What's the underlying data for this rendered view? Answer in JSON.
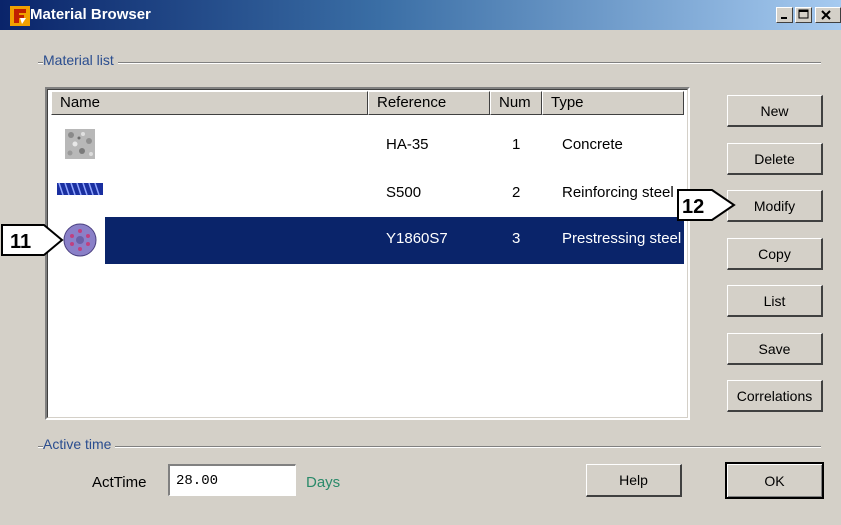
{
  "window": {
    "title": "Material Browser",
    "controls": [
      "minimize",
      "maximize",
      "close"
    ]
  },
  "material_list": {
    "group_label": "Material list",
    "columns": [
      "Name",
      "Reference",
      "Num",
      "Type"
    ],
    "rows": [
      {
        "icon": "concrete-texture-icon",
        "reference": "HA-35",
        "num": "1",
        "type": "Concrete",
        "selected": false
      },
      {
        "icon": "rebar-icon",
        "reference": "S500",
        "num": "2",
        "type": "Reinforcing steel",
        "selected": false
      },
      {
        "icon": "prestressing-strand-icon",
        "reference": "Y1860S7",
        "num": "3",
        "type": "Prestressing steel",
        "selected": true
      }
    ]
  },
  "buttons": {
    "new": "New",
    "delete": "Delete",
    "modify": "Modify",
    "copy": "Copy",
    "list": "List",
    "save": "Save",
    "correlations": "Correlations",
    "help": "Help",
    "ok": "OK"
  },
  "active_time": {
    "group_label": "Active time",
    "label": "ActTime",
    "value": "28.00",
    "unit": "Days"
  },
  "callouts": {
    "left": "11",
    "right": "12"
  },
  "colors": {
    "selection": "#0a246a",
    "title_gradient_start": "#0a246a",
    "title_gradient_end": "#a6caf0",
    "group_label": "#2a4d8f",
    "unit_label": "#2a8a6a"
  }
}
